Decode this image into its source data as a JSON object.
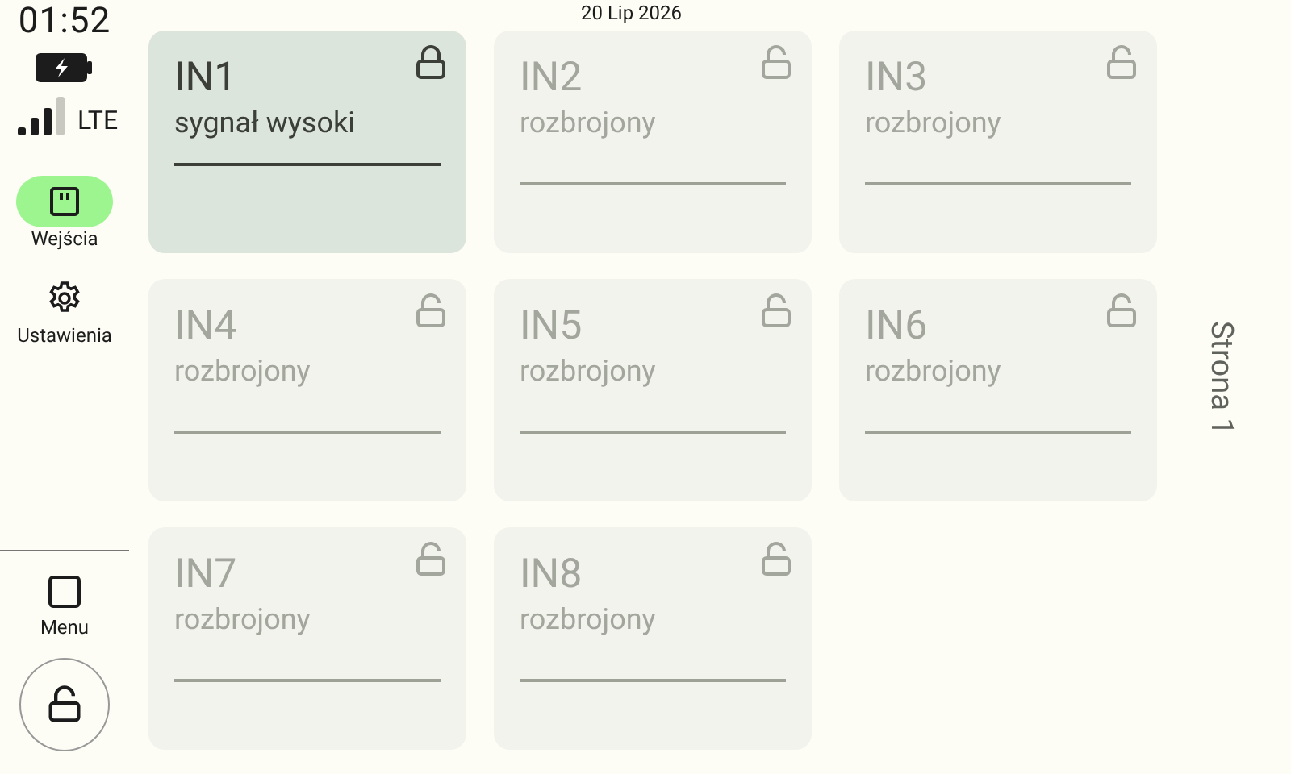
{
  "status": {
    "time": "01:52",
    "network": "LTE",
    "date": "20 Lip 2026",
    "charging": true
  },
  "nav": [
    {
      "label": "Wejścia",
      "kind": "inputs",
      "selected": true
    },
    {
      "label": "Ustawienia",
      "kind": "settings",
      "selected": false
    }
  ],
  "menu": {
    "label": "Menu"
  },
  "lock_button": {
    "locked": false
  },
  "inputs": [
    {
      "name": "IN1",
      "state": "sygnał wysoki",
      "armed": true
    },
    {
      "name": "IN2",
      "state": "rozbrojony",
      "armed": false
    },
    {
      "name": "IN3",
      "state": "rozbrojony",
      "armed": false
    },
    {
      "name": "IN4",
      "state": "rozbrojony",
      "armed": false
    },
    {
      "name": "IN5",
      "state": "rozbrojony",
      "armed": false
    },
    {
      "name": "IN6",
      "state": "rozbrojony",
      "armed": false
    },
    {
      "name": "IN7",
      "state": "rozbrojony",
      "armed": false
    },
    {
      "name": "IN8",
      "state": "rozbrojony",
      "armed": false
    }
  ],
  "page_label": "Strona 1"
}
